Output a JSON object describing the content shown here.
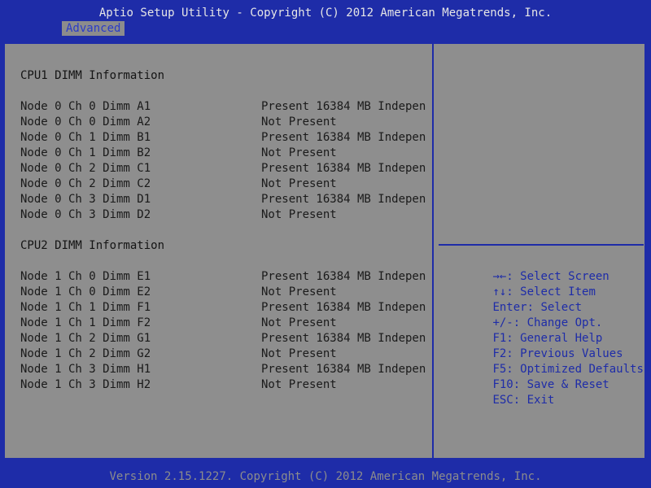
{
  "header": {
    "title": "Aptio Setup Utility - Copyright (C) 2012 American Megatrends, Inc.",
    "tabs": [
      {
        "label": "Advanced",
        "active": true
      }
    ]
  },
  "main": {
    "sections": [
      {
        "title": "CPU1 DIMM Information",
        "rows": [
          {
            "label": "Node 0 Ch 0 Dimm A1",
            "value": "Present 16384 MB Indepen"
          },
          {
            "label": "Node 0 Ch 0 Dimm A2",
            "value": "Not Present"
          },
          {
            "label": "Node 0 Ch 1 Dimm B1",
            "value": "Present 16384 MB Indepen"
          },
          {
            "label": "Node 0 Ch 1 Dimm B2",
            "value": "Not Present"
          },
          {
            "label": "Node 0 Ch 2 Dimm C1",
            "value": "Present 16384 MB Indepen"
          },
          {
            "label": "Node 0 Ch 2 Dimm C2",
            "value": "Not Present"
          },
          {
            "label": "Node 0 Ch 3 Dimm D1",
            "value": "Present 16384 MB Indepen"
          },
          {
            "label": "Node 0 Ch 3 Dimm D2",
            "value": "Not Present"
          }
        ]
      },
      {
        "title": "CPU2 DIMM Information",
        "rows": [
          {
            "label": "Node 1 Ch 0 Dimm E1",
            "value": "Present 16384 MB Indepen"
          },
          {
            "label": "Node 1 Ch 0 Dimm E2",
            "value": "Not Present"
          },
          {
            "label": "Node 1 Ch 1 Dimm F1",
            "value": "Present 16384 MB Indepen"
          },
          {
            "label": "Node 1 Ch 1 Dimm F2",
            "value": "Not Present"
          },
          {
            "label": "Node 1 Ch 2 Dimm G1",
            "value": "Present 16384 MB Indepen"
          },
          {
            "label": "Node 1 Ch 2 Dimm G2",
            "value": "Not Present"
          },
          {
            "label": "Node 1 Ch 3 Dimm H1",
            "value": "Present 16384 MB Indepen"
          },
          {
            "label": "Node 1 Ch 3 Dimm H2",
            "value": "Not Present"
          }
        ]
      }
    ]
  },
  "help": {
    "items": [
      {
        "key": "→←:",
        "desc": " Select Screen"
      },
      {
        "key": "↑↓:",
        "desc": " Select Item"
      },
      {
        "key": "Enter:",
        "desc": " Select"
      },
      {
        "key": "+/-:",
        "desc": " Change Opt."
      },
      {
        "key": "F1:",
        "desc": " General Help"
      },
      {
        "key": "F2:",
        "desc": " Previous Values"
      },
      {
        "key": "F5:",
        "desc": " Optimized Defaults"
      },
      {
        "key": "F10:",
        "desc": " Save & Reset"
      },
      {
        "key": "ESC:",
        "desc": " Exit"
      }
    ]
  },
  "footer": {
    "text": "Version 2.15.1227. Copyright (C) 2012 American Megatrends, Inc."
  },
  "colors": {
    "frame_blue": "#1e2ca8",
    "panel_gray": "#8e8e8e",
    "text_dark": "#1a1a1a",
    "help_blue": "#1e2ca8",
    "title_white": "#e6e6e6",
    "footer_gray": "#8c8c8c"
  }
}
